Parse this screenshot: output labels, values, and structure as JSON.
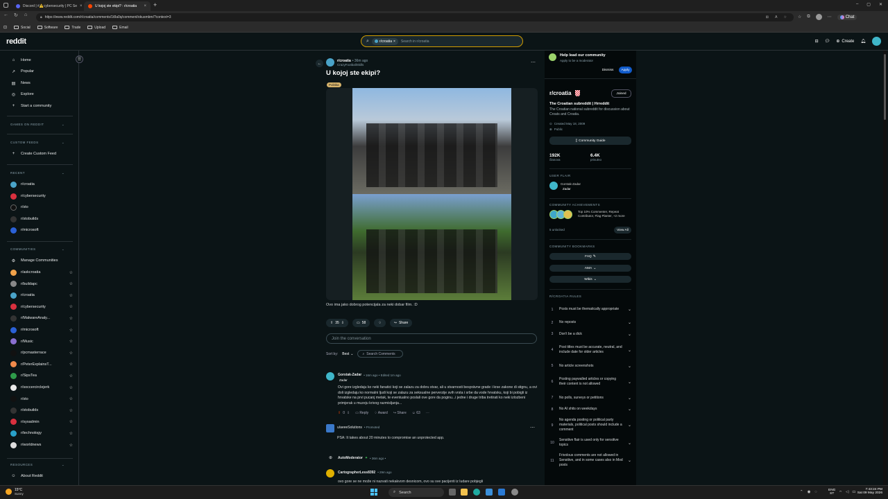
{
  "browser": {
    "tabs": [
      {
        "label": "Discord | #⚠️cybersecurity | PC Se",
        "active": false,
        "color": "#5865f2"
      },
      {
        "label": "U kojoj ste ekipi? : r/croatia",
        "active": true,
        "color": "#ff4500"
      }
    ],
    "url": "https://www.reddit.com/r/croatia/comments/1t8a0q/comment/okusmbm/?context=3",
    "bookmarks": [
      "Social",
      "Software",
      "Trade",
      "Upload",
      "Email"
    ],
    "chat_label": "Chat"
  },
  "header": {
    "logo": "reddit",
    "search_chip": "r/croatia",
    "search_placeholder": "Search in r/croatia",
    "create_label": "Create"
  },
  "sidebar": {
    "main": [
      {
        "label": "Home",
        "icon": "home-icon"
      },
      {
        "label": "Popular",
        "icon": "popular-icon"
      },
      {
        "label": "News",
        "icon": "news-icon"
      },
      {
        "label": "Explore",
        "icon": "explore-icon"
      },
      {
        "label": "Start a community",
        "icon": "plus-icon"
      }
    ],
    "games_header": "GAMES ON REDDIT",
    "custom_header": "CUSTOM FEEDS",
    "create_feed": "Create Custom Feed",
    "recent_header": "RECENT",
    "recent": [
      "r/croatia",
      "r/cybersecurity",
      "r/sto",
      "r/stobuilds",
      "r/microsoft"
    ],
    "communities_header": "COMMUNITIES",
    "manage": "Manage Communities",
    "communities": [
      "r/askcroatia",
      "r/buildapc",
      "r/croatia",
      "r/cybersecurity",
      "r/MalwareAnaly...",
      "r/microsoft",
      "r/Music",
      "r/pcmasterrace",
      "r/PeterExplainsT...",
      "r/SipsTea",
      "r/soccercirclejerk",
      "r/sto",
      "r/stobuilds",
      "r/sysadmin",
      "r/technology",
      "r/worldnews"
    ],
    "resources_header": "RESOURCES",
    "about": "About Reddit"
  },
  "post": {
    "subreddit": "r/croatia",
    "time": "• 36m ago",
    "author": "CrazyFootballSkills",
    "title": "U kojoj ste ekipi?",
    "flair": "Politika",
    "body": "Ovo ima jako dobrog potencijala za neki dobar film. :D",
    "votes": "35",
    "comments": "58",
    "share": "Share",
    "join_placeholder": "Join the conversation",
    "sort_label": "Sort by:",
    "sort_value": "Best",
    "search_comments": "Search Comments"
  },
  "comments": [
    {
      "author": "Gorstak-Zadar",
      "meta": "• 16m ago • Edited 1m ago",
      "flair": "Zadar",
      "text": "Ovi gore izgledaju ko neki fanatici koji se zalazu za dobru stvar, ali u stvarnosti besprávne grade i krse zakone di stignu, a ovi doli izgledaju ko normalni ljudi koji se zalazu za seksualne perverzije svih vrsta i srbe da vode hrvatsku, koji bi pobigli iz hrvatske na prvi pucanj metak, te eventualno poslali ove gore da poginu...i jedne i druge triba tretirati ko neki izlozbeni primjerak u muzeju krivog razmisljanja...",
      "votes": "0",
      "reply": "Reply",
      "award": "Award",
      "share": "Share",
      "count": "63"
    }
  ],
  "promoted": {
    "author": "u/aeeeSolutions",
    "tag": "• Promoted",
    "text": "PSA: It takes about 20 minutes to compromise an unprotected app."
  },
  "automod": {
    "author": "AutoModerator",
    "meta": "• 36m ago •"
  },
  "comment3": {
    "author": "CartographerLess8392",
    "meta": "• 29m ago",
    "text": "ovo gore se ne može ni nazvati nekakvom desnicom, ovo su sve pacijenti iz ludare pobjegli"
  },
  "right": {
    "help_title": "Help lead our community",
    "help_sub": "Apply to be a moderator",
    "dismiss": "Dismiss",
    "apply": "Apply",
    "sub_name": "r/croatia",
    "joined": "Joined",
    "desc_title": "The Croatian subreddit | Hrreddit",
    "desc": "The Croatian national subreddit for discussion about Croats and Croatia.",
    "created": "Created May 18, 2009",
    "visibility": "Public",
    "guide": "Community Guide",
    "members": "192K",
    "members_label": "članova",
    "online": "6.4K",
    "online_label": "prisutno",
    "user_flair_title": "USER FLAIR",
    "user_flair_name": "Gorstak-Zadar",
    "user_flair_tag": "Zadar",
    "achievements_title": "COMMUNITY ACHIEVEMENTS",
    "achievements_text": "Top 10% Commenter, Repeat Contributor, Flag Planter, +2 more",
    "unlocked": "5 unlocked",
    "view_all": "View All",
    "bookmarks_title": "COMMUNITY BOOKMARKS",
    "bookmarks": [
      "FAQ",
      "AMA",
      "Wikis"
    ],
    "rules_title": "R/CROATIA RULES",
    "rules": [
      "Posts must be thematically appropriate",
      "No reposts",
      "Don't be a dick",
      "Post titles must be accurate, neutral, and include date for older articles",
      "No article screenshots",
      "Posting paywalled articles or copying their content is not allowed",
      "No polls, surveys or petitions",
      "No AI shits on weekdays",
      "No agenda posting or political party materials, political posts should include a comment",
      "Sensitive flair is used only for sensitive topics",
      "Frivolous comments are not allowed in Sensitive, and in some cases also in Mod posts"
    ]
  },
  "taskbar": {
    "temp": "15°C",
    "weather": "Sunny",
    "search": "Search",
    "lang1": "ENG",
    "lang2": "ST",
    "time": "7:43:24 PM",
    "date": "Sat 09 May 2026"
  },
  "colors": {
    "accent": "#d39e00",
    "bg": "#0b1416",
    "apply": "#115bca",
    "upvote": "#ff4500"
  }
}
